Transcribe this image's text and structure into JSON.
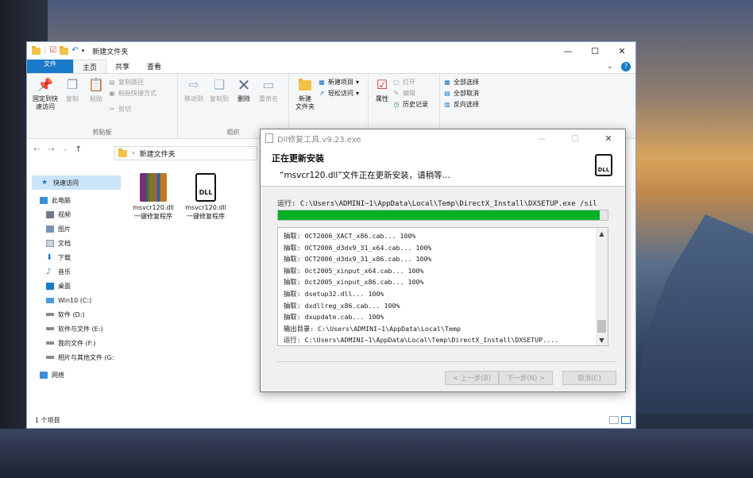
{
  "explorer": {
    "title": "新建文件夹",
    "tabs": [
      "文件",
      "主页",
      "共享",
      "查看"
    ],
    "ribbon": {
      "clipboard": {
        "pin": "固定到快\n速访问",
        "copy": "复制",
        "paste": "粘贴",
        "copy_path": "复制路径",
        "paste_shortcut": "粘贴快捷方式",
        "cut": "剪切",
        "label": "剪贴板"
      },
      "organize": {
        "move_to": "移动到",
        "copy_to": "复制到",
        "delete": "删除",
        "rename": "重命名",
        "label": "组织"
      },
      "new": {
        "new_folder": "新建\n文件夹",
        "new_item": "新建项目",
        "easy_access": "轻松访问"
      },
      "open": {
        "properties": "属性",
        "open": "打开",
        "edit": "编辑",
        "history": "历史记录"
      },
      "select": {
        "select_all": "全部选择",
        "select_none": "全部取消",
        "invert": "反向选择"
      }
    },
    "address": "新建文件夹",
    "nav": [
      {
        "label": "快速访问",
        "kind": "quick"
      },
      {
        "label": "此电脑",
        "kind": "pc"
      },
      {
        "label": "视频",
        "kind": "sub"
      },
      {
        "label": "图片",
        "kind": "sub"
      },
      {
        "label": "文档",
        "kind": "sub"
      },
      {
        "label": "下载",
        "kind": "sub"
      },
      {
        "label": "音乐",
        "kind": "sub"
      },
      {
        "label": "桌面",
        "kind": "sub"
      },
      {
        "label": "Win10 (C:)",
        "kind": "sub"
      },
      {
        "label": "软件 (D:)",
        "kind": "sub"
      },
      {
        "label": "软件与文件 (E:)",
        "kind": "sub"
      },
      {
        "label": "我的文件 (F:)",
        "kind": "sub"
      },
      {
        "label": "相片与其他文件 (G:",
        "kind": "sub"
      },
      {
        "label": "网络",
        "kind": "net"
      }
    ],
    "files": [
      {
        "name": "msvcr120.dll\n一键修复程序",
        "icon": "winrar-archive-icon"
      },
      {
        "name": "msvcr120.dll\n一键修复程序",
        "icon": "dll-file-icon"
      }
    ],
    "status": "1 个项目"
  },
  "dialog": {
    "title": "Dll修复工具.v9.23.exe",
    "heading": "正在更新安装",
    "subheading": "“msvcr120.dll”文件正在更新安装，请稍等...",
    "run_line": "运行: C:\\Users\\ADMINI~1\\AppData\\Local\\Temp\\DirectX_Install\\DXSETUP.exe /sil",
    "progress": 0.975,
    "log": [
      "抽取: OCT2006_XACT_x86.cab... 100%",
      "抽取: OCT2006_d3dx9_31_x64.cab... 100%",
      "抽取: OCT2006_d3dx9_31_x86.cab... 100%",
      "抽取: Oct2005_xinput_x64.cab... 100%",
      "抽取: Oct2005_xinput_x86.cab... 100%",
      "抽取: dsetup32.dll... 100%",
      "抽取: dxdllreg_x86.cab... 100%",
      "抽取: dxupdate.cab... 100%",
      "输出目录: C:\\Users\\ADMINI~1\\AppData\\Local\\Temp",
      "运行: C:\\Users\\ADMINI~1\\AppData\\Local\\Temp\\DirectX_Install\\DXSETUP...."
    ],
    "buttons": {
      "back": "< 上一步(B)",
      "next": "下一步(N) >",
      "cancel": "取消(C)"
    }
  },
  "colors": {
    "accent": "#1979ca",
    "progress": "#06b025"
  }
}
